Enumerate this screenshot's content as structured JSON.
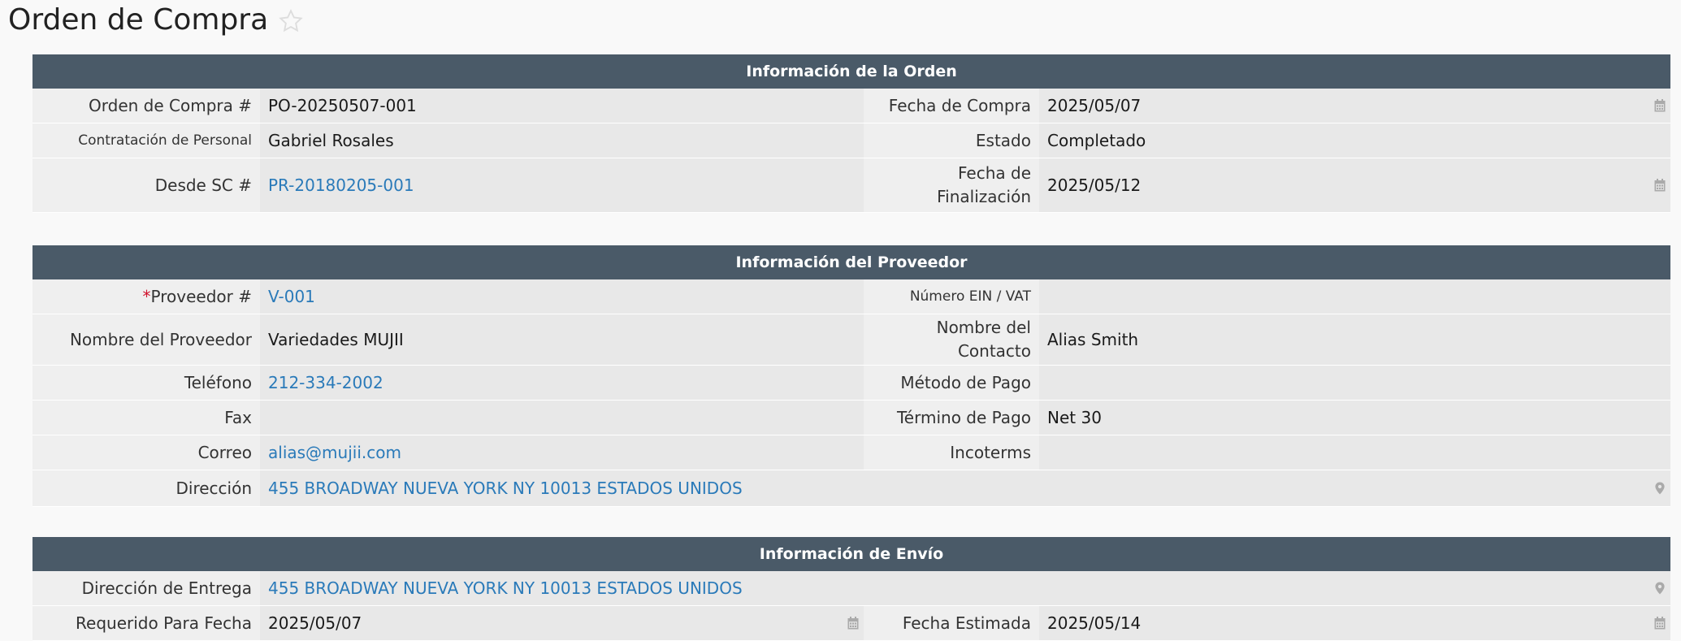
{
  "page": {
    "title": "Orden de Compra"
  },
  "order_info": {
    "header": "Información de la Orden",
    "po_label": "Orden de Compra #",
    "po_value": "PO-20250507-001",
    "purchase_date_label": "Fecha de Compra",
    "purchase_date_value": "2025/05/07",
    "staff_label": "Contratación de Personal",
    "staff_value": "Gabriel Rosales",
    "status_label": "Estado",
    "status_value": "Completado",
    "from_pr_label": "Desde SC #",
    "from_pr_value": "PR-20180205-001",
    "completion_label": "Fecha de Finalización",
    "completion_value": "2025/05/12"
  },
  "vendor_info": {
    "header": "Información del Proveedor",
    "required_mark": "*",
    "vendor_label": "Proveedor #",
    "vendor_value": "V-001",
    "ein_label": "Número EIN / VAT",
    "ein_value": "",
    "name_label": "Nombre del Proveedor",
    "name_value": "Variedades MUJII",
    "contact_label": "Nombre del Contacto",
    "contact_value": "Alias Smith",
    "phone_label": "Teléfono",
    "phone_value": "212-334-2002",
    "payment_method_label": "Método de Pago",
    "payment_method_value": "",
    "fax_label": "Fax",
    "fax_value": "",
    "payment_term_label": "Término de Pago",
    "payment_term_value": "Net 30",
    "email_label": "Correo",
    "email_value": "alias@mujii.com",
    "incoterms_label": "Incoterms",
    "incoterms_value": "",
    "address_label": "Dirección",
    "address_value": "455 BROADWAY NUEVA YORK NY 10013 ESTADOS UNIDOS"
  },
  "shipping_info": {
    "header": "Información de Envío",
    "delivery_address_label": "Dirección de Entrega",
    "delivery_address_value": "455 BROADWAY NUEVA YORK NY 10013 ESTADOS UNIDOS",
    "required_date_label": "Requerido Para Fecha",
    "required_date_value": "2025/05/07",
    "estimated_date_label": "Fecha Estimada",
    "estimated_date_value": "2025/05/14"
  },
  "colors": {
    "section_header_bg": "#4a5a68",
    "link": "#2a7ab9",
    "required": "#d0112b"
  }
}
